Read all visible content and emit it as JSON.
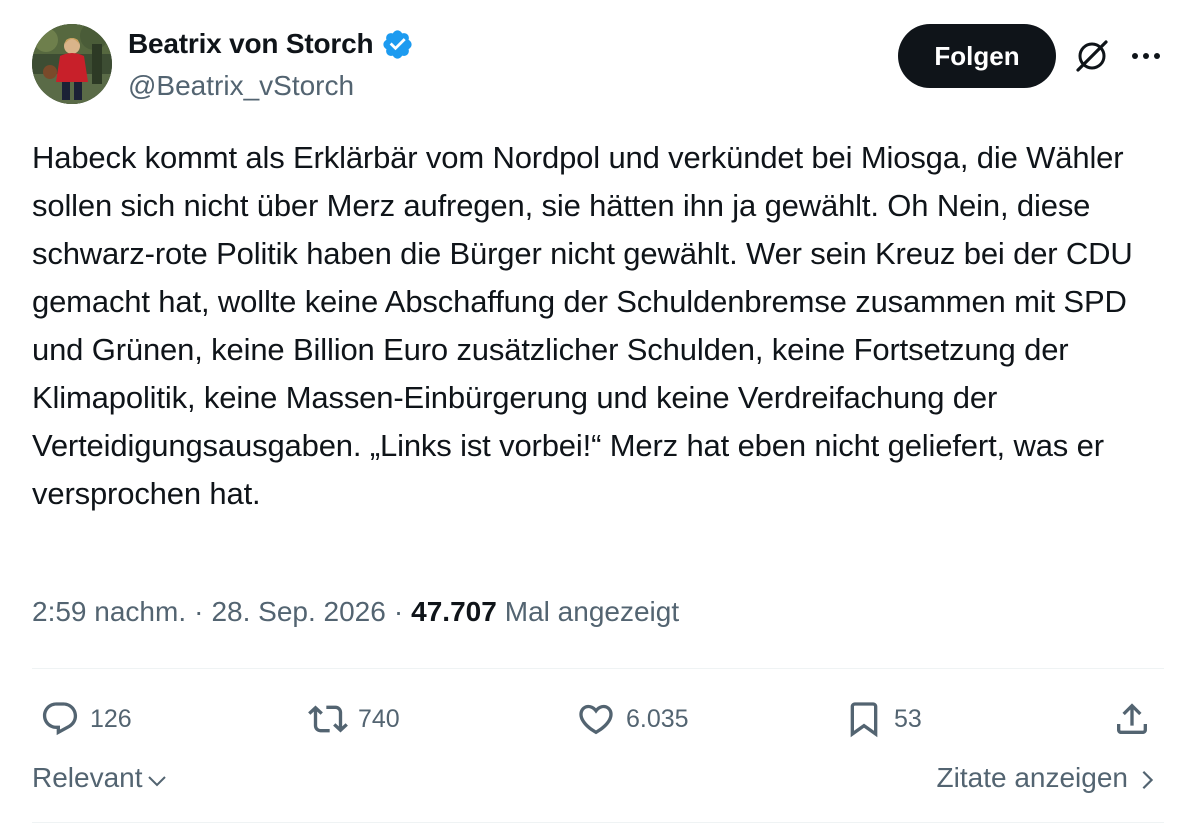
{
  "author": {
    "display_name": "Beatrix von Storch",
    "handle": "@Beatrix_vStorch",
    "verified_icon": "verified-badge-icon",
    "verified_color": "#1d9bf0"
  },
  "header": {
    "follow_label": "Folgen",
    "grok_icon": "grok-icon",
    "more_icon": "more-icon"
  },
  "tweet": {
    "text": "Habeck kommt als Erklärbär vom Nordpol und verkündet bei Miosga, die Wähler sollen sich nicht über Merz aufregen, sie hätten ihn ja gewählt. Oh Nein, diese schwarz-rote Politik haben die Bürger nicht gewählt. Wer sein Kreuz bei der CDU gemacht hat, wollte keine Abschaffung der Schuldenbremse zusammen mit SPD und Grünen, keine Billion Euro zusätzlicher Schulden, keine Fortsetzung der Klimapolitik, keine Massen-Einbürgerung und keine Verdreifachung der Verteidigungsausgaben. „Links ist vorbei!“ Merz hat eben nicht geliefert, was er versprochen hat.",
    "time": "2:59 nachm.",
    "date": "28. Sep. 2026",
    "separator": "·",
    "views_count": "47.707",
    "views_label": "Mal angezeigt"
  },
  "actions": {
    "replies": "126",
    "reposts": "740",
    "likes": "6.035",
    "bookmarks": "53"
  },
  "footer": {
    "sort_label": "Relevant",
    "quotes_label": "Zitate anzeigen"
  },
  "colors": {
    "text_primary": "#0f1419",
    "text_secondary": "#536471",
    "follow_bg": "#0f1419",
    "divider": "#eff3f4"
  }
}
